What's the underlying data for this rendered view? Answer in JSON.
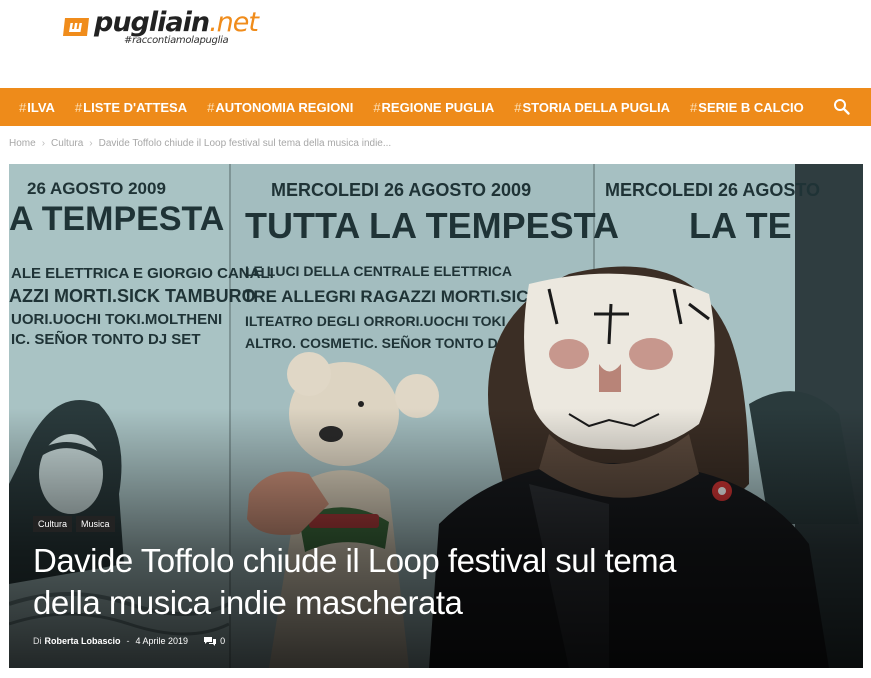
{
  "logo": {
    "name_a": "pugliain",
    "name_b": ".net",
    "tagline": "#raccontiamolapuglia"
  },
  "nav": {
    "items": [
      {
        "hash": "#",
        "label": "ILVA"
      },
      {
        "hash": "#",
        "label": "LISTE D'ATTESA"
      },
      {
        "hash": "#",
        "label": "AUTONOMIA REGIONI"
      },
      {
        "hash": "#",
        "label": "REGIONE PUGLIA"
      },
      {
        "hash": "#",
        "label": "STORIA DELLA PUGLIA"
      },
      {
        "hash": "#",
        "label": "SERIE B CALCIO"
      }
    ],
    "search_icon": "search-icon"
  },
  "breadcrumb": {
    "home": "Home",
    "section": "Cultura",
    "current": "Davide Toffolo chiude il Loop festival sul tema della musica indie..."
  },
  "article": {
    "categories": [
      "Cultura",
      "Musica"
    ],
    "title": "Davide Toffolo chiude il Loop festival sul tema della musica indie mascherata",
    "meta": {
      "by": "Di",
      "author": "Roberta Lobascio",
      "dash": "-",
      "date": "4 Aprile 2019",
      "comments": "0"
    }
  },
  "poster": {
    "p1": [
      "26 AGOSTO 2009",
      "A TEMPESTA",
      "ALE ELETTRICA E GIORGIO CANALI",
      "AZZI MORTI.SICK TAMBURO",
      "UORI.UOCHI TOKI.MOLTHENI",
      "IC. SEÑOR TONTO DJ SET"
    ],
    "p2": [
      "MERCOLEDI 26 AGOSTO 2009",
      "TUTTA LA TEMPESTA",
      "LE LUCI DELLA CENTRALE ELETTRICA",
      "TRE ALLEGRI RAGAZZI MORTI.SICK T",
      "ILTEATRO DEGLI ORRORI.UOCHI TOKI",
      "ALTRO. COSMETIC. SEÑOR TONTO DJ"
    ],
    "p3": [
      "MERCOLEDI 26 AGOSTO",
      "LA TE"
    ]
  },
  "colors": {
    "nav_bg": "#ee8b1a",
    "logo_accent": "#f08c1b",
    "poster_bg": "#a9c3c4"
  }
}
